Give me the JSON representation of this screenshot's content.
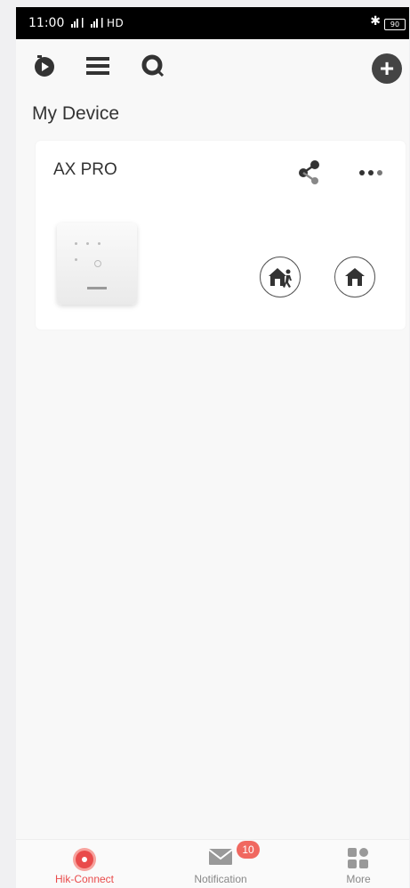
{
  "statusbar": {
    "time": "11:00",
    "network": " ıl  ıl HDв",
    "battery": "90"
  },
  "main": {
    "section_title": "My Device"
  },
  "device": {
    "name": "AX PRO"
  },
  "tabbar": {
    "tabs": [
      {
        "label": "Hik-Connect",
        "active": true
      },
      {
        "label": "Notification",
        "active": false
      },
      {
        "label": "More",
        "active": false
      }
    ],
    "notification_badge": "10"
  },
  "colors": {
    "accent": "#e94b4b",
    "badge": "#f06860",
    "icon_dark": "#333333",
    "inactive_label": "#888888"
  }
}
